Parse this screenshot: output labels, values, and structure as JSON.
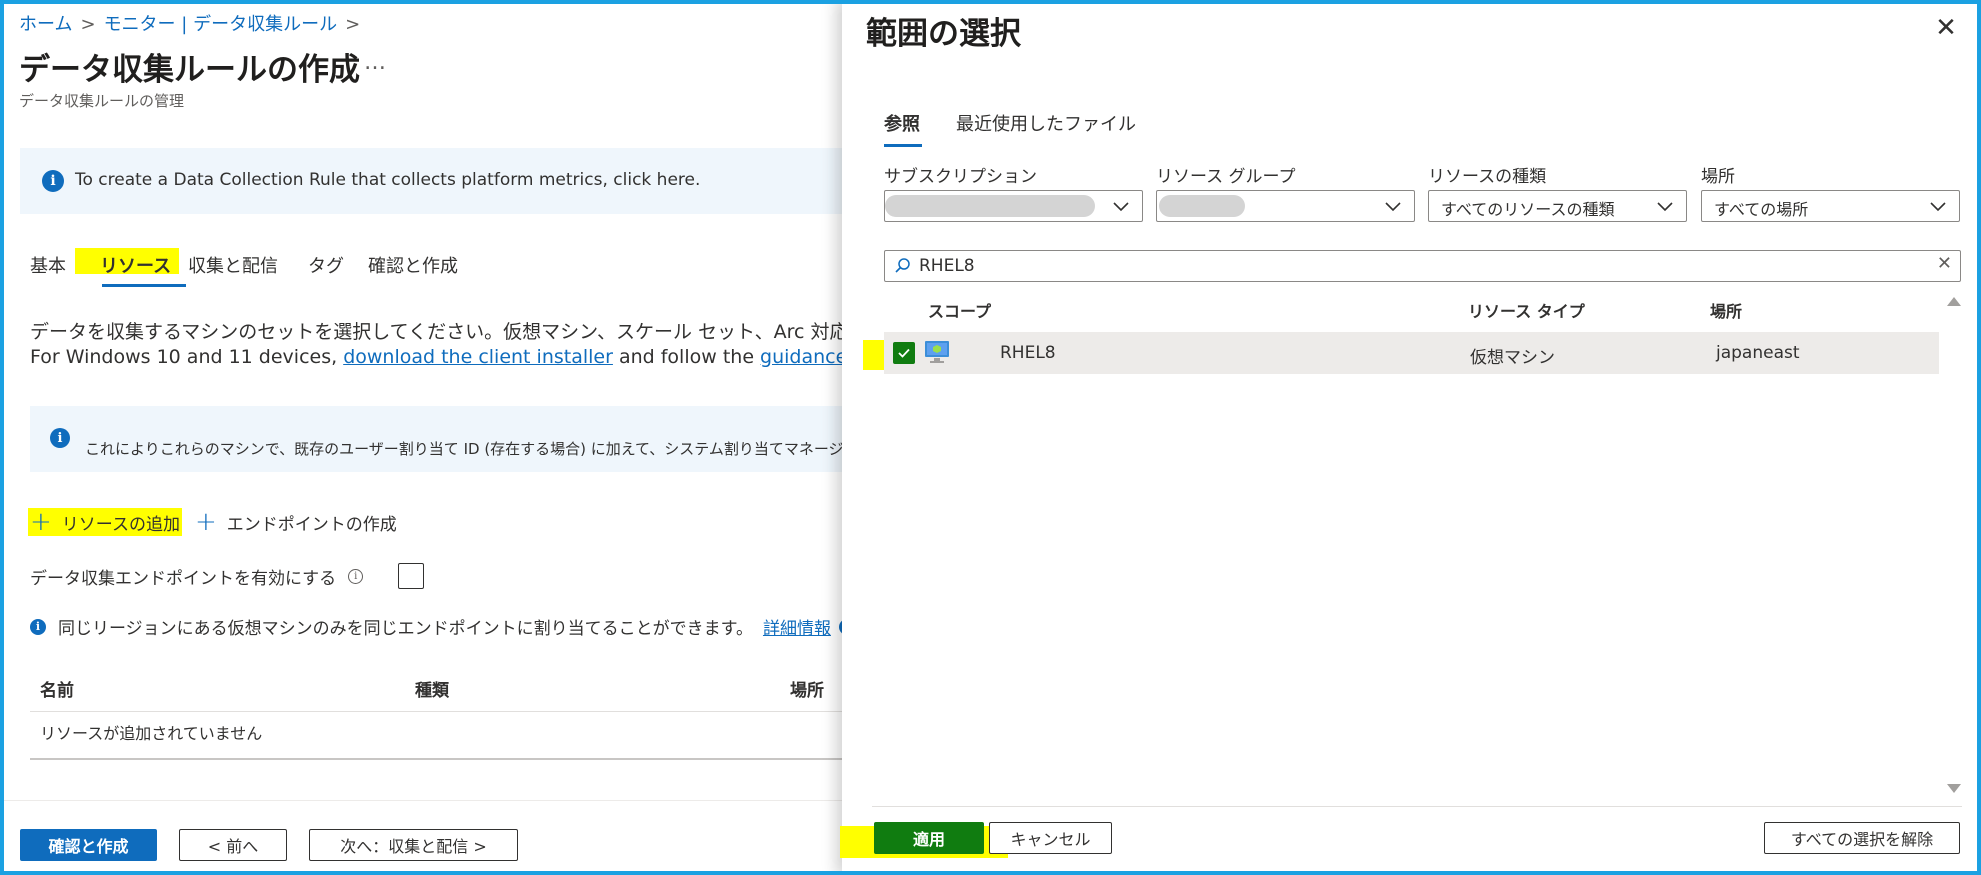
{
  "breadcrumb": {
    "home": "ホーム",
    "monitor": "モニター | データ収集ルール",
    "sep": ">"
  },
  "page": {
    "title": "データ収集ルールの作成",
    "more": "…",
    "subtitle": "データ収集ルールの管理"
  },
  "info_banner": {
    "icon": "info-icon",
    "text": "To create a Data Collection Rule that collects platform metrics, click here."
  },
  "tabs": {
    "basic": "基本",
    "resources": "リソース",
    "collect": "収集と配信",
    "tags": "タグ",
    "review": "確認と作成"
  },
  "description": {
    "line1": "データを収集するマシンのセットを選択してください。仮想マシン、スケール セット、Arc 対応サーバーには、Azure",
    "line2_prefix": "For Windows 10 and 11 devices, ",
    "link1": "download the client installer",
    "line2_mid": " and follow the ",
    "link2": "guidance"
  },
  "info2": {
    "icon": "info-icon",
    "text": "これによりこれらのマシンで、既存のユーザー割り当て ID (存在する場合) に加えて、システム割り当てマネージド ID も有"
  },
  "actions": {
    "add_resource": "リソースの追加",
    "create_endpoint": "エンドポイントの作成",
    "plus": "+"
  },
  "endpoint_toggle": {
    "label": "データ収集エンドポイントを有効にする",
    "info": "i"
  },
  "region_note": {
    "text": "同じリージョンにある仮想マシンのみを同じエンドポイントに割り当てることができます。",
    "link": "詳細情報"
  },
  "resource_table": {
    "headers": [
      "名前",
      "種類",
      "場所"
    ],
    "empty": "リソースが追加されていません"
  },
  "footer": {
    "review": "確認と作成",
    "prev": "< 前へ",
    "next": "次へ：収集と配信 >"
  },
  "panel": {
    "title": "範囲の選択",
    "close": "✕",
    "tabs": {
      "browse": "参照",
      "recent": "最近使用したファイル"
    },
    "filters": {
      "subscription": {
        "label": "サブスクリプション",
        "value": ""
      },
      "resource_group": {
        "label": "リソース グループ",
        "value": ""
      },
      "resource_type": {
        "label": "リソースの種類",
        "value": "すべてのリソースの種類"
      },
      "location": {
        "label": "場所",
        "value": "すべての場所"
      }
    },
    "search": {
      "value": "RHEL8",
      "clear": "✕"
    },
    "grid": {
      "headers": {
        "scope": "スコープ",
        "type": "リソース タイプ",
        "location": "場所"
      },
      "rows": [
        {
          "name": "RHEL8",
          "type": "仮想マシン",
          "location": "japaneast",
          "checked": true
        }
      ]
    },
    "footer": {
      "apply": "適用",
      "cancel": "キャンセル",
      "clear_all": "すべての選択を解除"
    }
  },
  "colors": {
    "accent": "#0f6cbd",
    "highlight": "#ffff00",
    "success": "#107c10",
    "apply": "#107c10"
  }
}
